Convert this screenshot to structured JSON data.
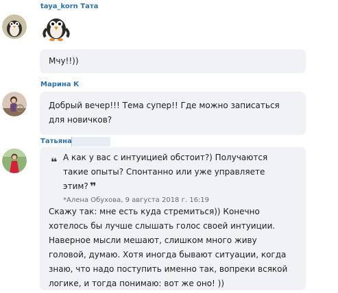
{
  "messages": [
    {
      "author": "taya_korn Тата",
      "avatar_icon": "penguin-avatar",
      "sticker_icon": "penguin-sticker",
      "text": "Мчу!!))"
    },
    {
      "author": "Марина К",
      "avatar_icon": "woman-avatar",
      "text": "Добрый вечер!!! Тема супер!! Где можно записаться\nдля новичков?"
    },
    {
      "author": "Татьяна",
      "avatar_icon": "woman-red-dress-avatar",
      "quote": {
        "open_mark": "❝",
        "close_mark": "❞",
        "text": "А как у вас с интуицией обстоит?) Получаются\nтакие опыты? Спонтанно или уже управляете\nэтим?",
        "meta": "*Алена Обухова, 9 августа 2018 г. 16:19"
      },
      "text": "Скажу так: мне есть куда стремиться)) Конечно\nхотелось бы лучше слышать голос своей интуиции.\nНаверное мысли мешают, слишком много живу\nголовой, думаю. Хотя иногда бывают ситуации, когда\nзнаю, что надо поступить именно так, вопреки всякой\nлогике, и тогда понимаю: вот же оно! ))"
    }
  ],
  "colors": {
    "author": "#2a6fa8",
    "bubble": "#f1f2f5",
    "text": "#1c1c1c"
  }
}
